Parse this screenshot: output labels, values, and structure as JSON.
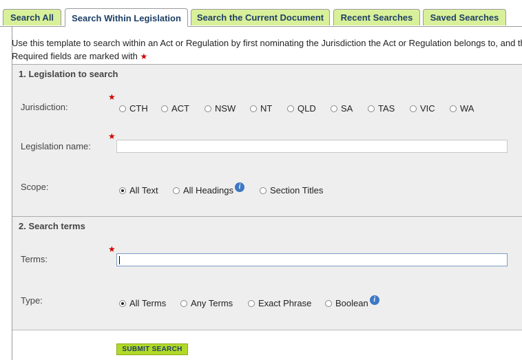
{
  "tabs": [
    {
      "label": "Search All",
      "active": false
    },
    {
      "label": "Search Within Legislation",
      "active": true
    },
    {
      "label": "Search the Current Document",
      "active": false
    },
    {
      "label": "Recent Searches",
      "active": false
    },
    {
      "label": "Saved Searches",
      "active": false
    }
  ],
  "intro": {
    "line1": "Use this template to search within an Act or Regulation by first nominating the Jurisdiction the Act or Regulation belongs to, and then",
    "line2": "Required fields are marked with"
  },
  "required_marker": "★",
  "section1": {
    "title": "1. Legislation to search",
    "jurisdiction": {
      "label": "Jurisdiction:",
      "options": [
        "CTH",
        "ACT",
        "NSW",
        "NT",
        "QLD",
        "SA",
        "TAS",
        "VIC",
        "WA"
      ],
      "selected": null
    },
    "legislation_name": {
      "label": "Legislation name:",
      "value": ""
    },
    "scope": {
      "label": "Scope:",
      "options": [
        "All Text",
        "All Headings",
        "Section Titles"
      ],
      "selected": "All Text"
    }
  },
  "section2": {
    "title": "2. Search terms",
    "terms": {
      "label": "Terms:",
      "value": ""
    },
    "type": {
      "label": "Type:",
      "options": [
        "All Terms",
        "Any Terms",
        "Exact Phrase",
        "Boolean"
      ],
      "selected": "All Terms"
    }
  },
  "submit_label": "SUBMIT SEARCH",
  "info_icon_glyph": "i",
  "colors": {
    "tab_bg": "#d9f09a",
    "tab_text": "#1d3f66",
    "section_bg": "#eeeeee",
    "required": "#cc0000",
    "submit_bg": "#b3d928",
    "info_icon": "#3d78c4"
  }
}
